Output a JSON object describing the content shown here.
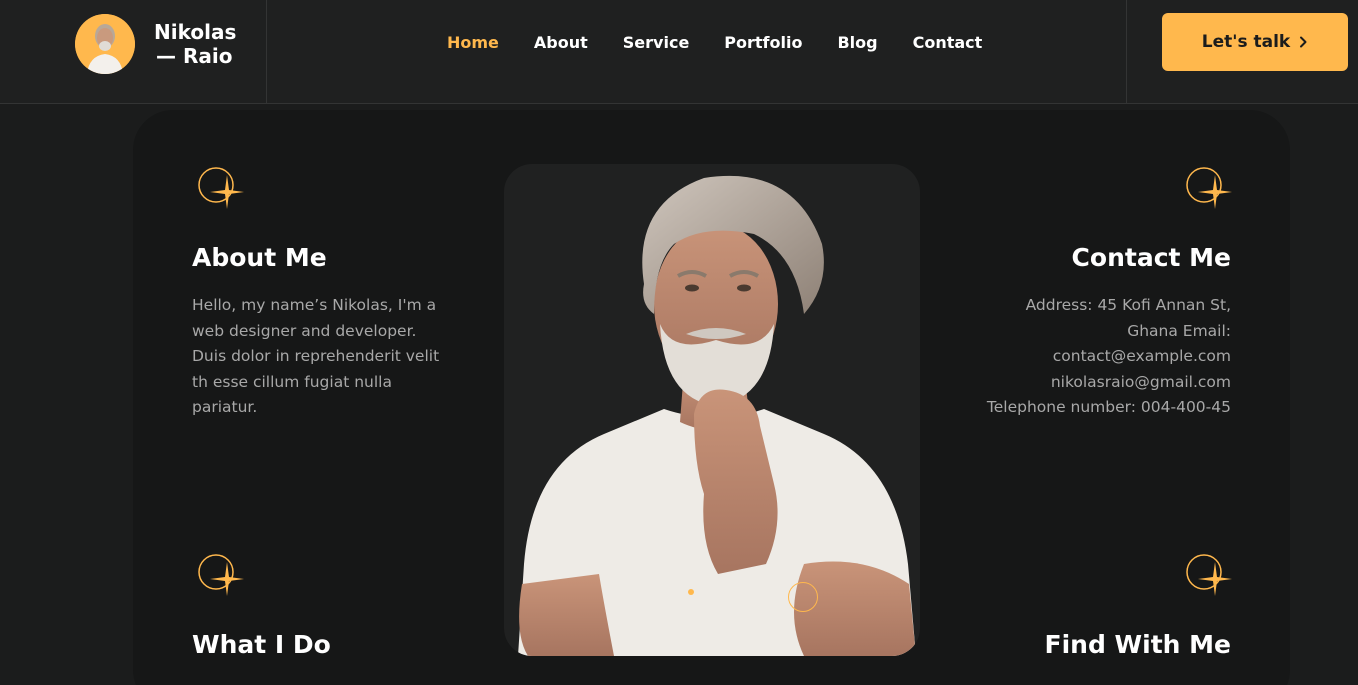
{
  "brand": {
    "name_line1": "Nikolas",
    "name_line2": "— Raio"
  },
  "nav": {
    "items": [
      "Home",
      "About",
      "Service",
      "Portfolio",
      "Blog",
      "Contact"
    ],
    "active": "Home"
  },
  "header": {
    "cta_label": "Let's talk"
  },
  "about": {
    "title": "About Me",
    "text": [
      "Hello, my name’s Nikolas, I'm a",
      "web designer and developer.",
      "Duis dolor in reprehenderit velit",
      "th esse cillum fugiat nulla",
      "pariatur."
    ]
  },
  "contact": {
    "title": "Contact Me",
    "lines": [
      "Address: 45 Kofi Annan St,",
      "Ghana Email:",
      "contact@example.com",
      "nikolasraio@gmail.com",
      "Telephone number: 004-400-45"
    ]
  },
  "what_i_do": {
    "title": "What I Do"
  },
  "find_with_me": {
    "title": "Find With Me"
  },
  "colors": {
    "accent": "#ffb84d",
    "background": "#1b1c1c",
    "panel": "#161717",
    "muted_text": "#a8a8a8"
  },
  "icons": {
    "sparkle": "sparkle-circle-icon",
    "chevron": "chevron-right-icon"
  }
}
